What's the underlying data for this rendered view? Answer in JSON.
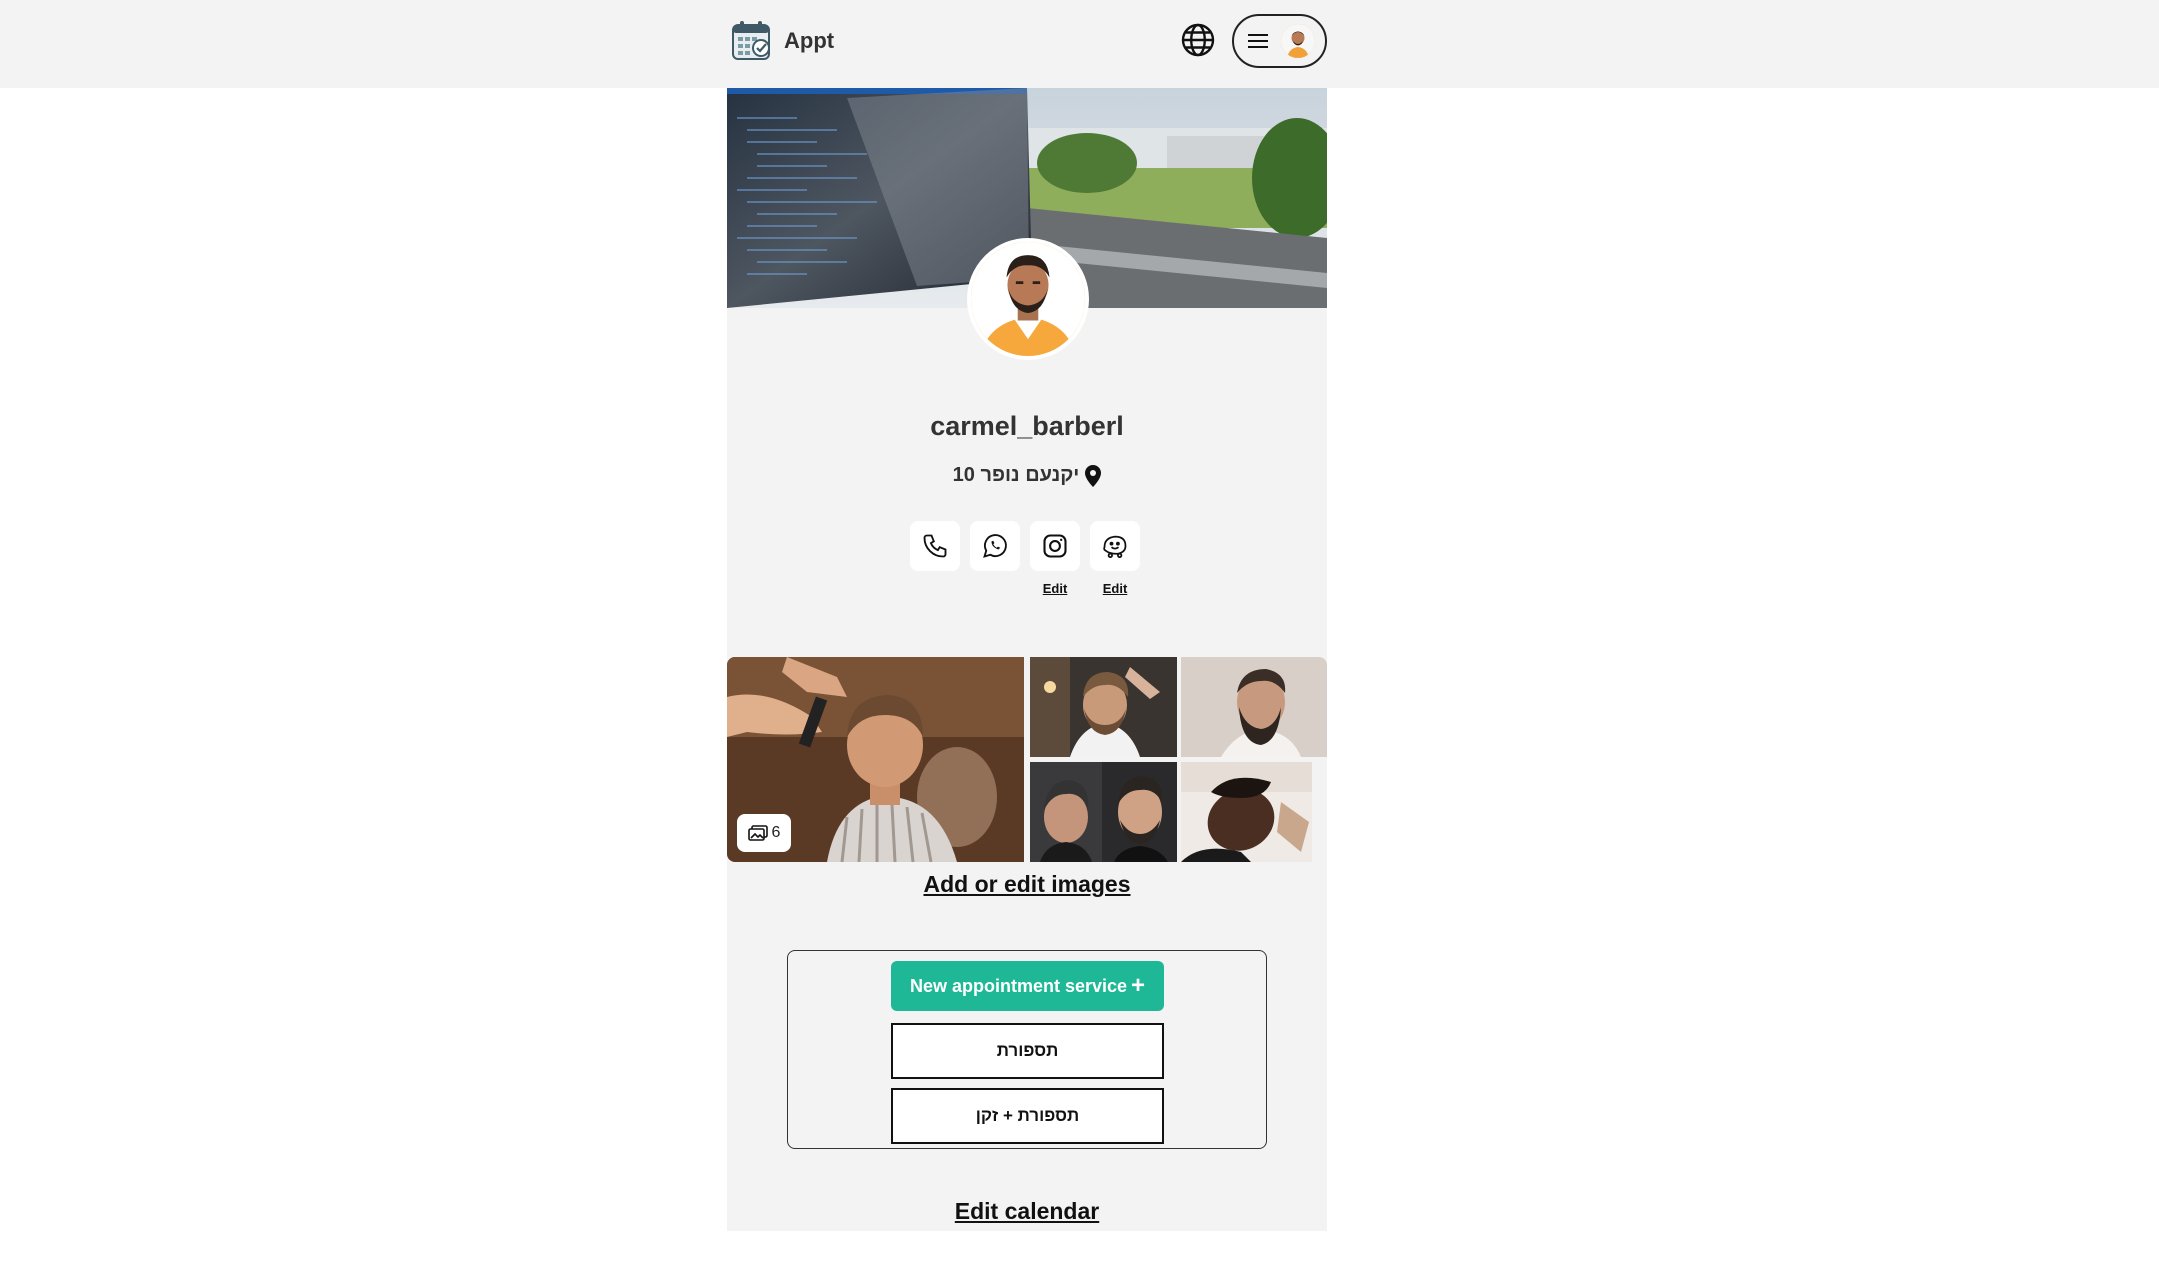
{
  "header": {
    "app_name": "Appt"
  },
  "profile": {
    "username": "carmel_barberl",
    "address": "יקנעם נופר 10"
  },
  "social": {
    "edit_label_instagram": "Edit",
    "edit_label_waze": "Edit",
    "icons": [
      "phone-icon",
      "whatsapp-icon",
      "instagram-icon",
      "waze-icon"
    ]
  },
  "gallery": {
    "image_count": "6",
    "add_edit_label": "Add or edit images"
  },
  "services": {
    "new_service_label": "New appointment service",
    "new_service_icon": "+",
    "items": [
      {
        "label": "תספורת"
      },
      {
        "label": "תספורת + זקן"
      }
    ]
  },
  "calendar": {
    "edit_label": "Edit calendar"
  },
  "colors": {
    "accent": "#1fb896",
    "card_background": "#f3f3f3",
    "topbar_background": "#f3f3f3"
  }
}
